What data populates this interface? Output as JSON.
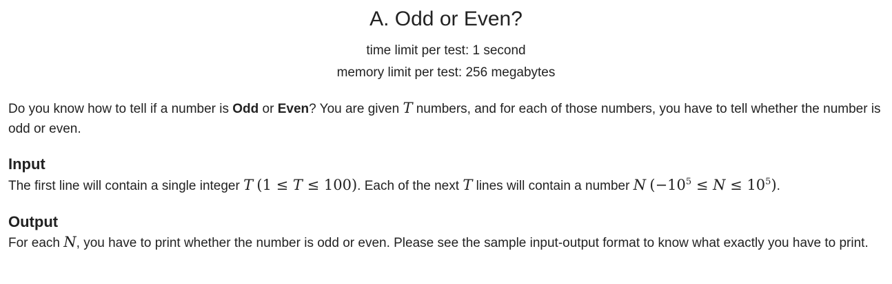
{
  "problem": {
    "title": "A. Odd or Even?",
    "time_limit": "time limit per test: 1 second",
    "memory_limit": "memory limit per test: 256 megabytes"
  },
  "statement": {
    "part1": "Do you know how to tell if a number is ",
    "bold_odd": "Odd",
    "part2": " or ",
    "bold_even": "Even",
    "part3": "? You are given ",
    "var_T": "T",
    "part4": " numbers, and for each of those numbers, you have to tell whether the number is odd or even."
  },
  "input": {
    "heading": "Input",
    "part1": "The first line will contain a single integer ",
    "var_T": "T",
    "constraint_T_open": "(1 ≤ ",
    "constraint_T_close": " ≤ 100)",
    "part2": ". Each of the next ",
    "part3": " lines will contain a number ",
    "var_N": "N",
    "constraint_N_open": "(−10",
    "exp": "5",
    "constraint_N_mid": " ≤ ",
    "constraint_N_mid2": " ≤ 10",
    "constraint_N_close": ")",
    "part4": "."
  },
  "output": {
    "heading": "Output",
    "part1": "For each ",
    "var_N": "N",
    "part2": ", you have to print whether the number is odd or even. Please see the sample input-output format to know what exactly you have to print."
  }
}
